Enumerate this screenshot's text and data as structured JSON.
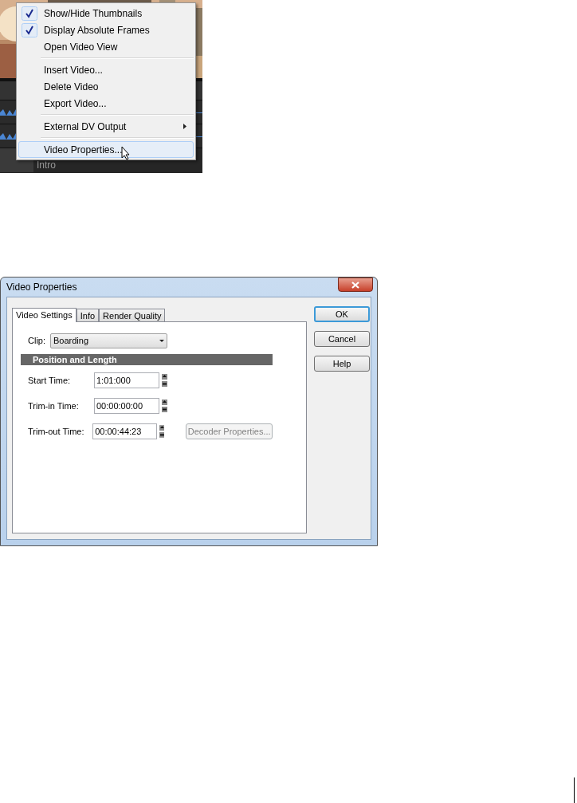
{
  "background": {
    "track_label": "Intro"
  },
  "context_menu": {
    "groups": [
      [
        {
          "label": "Show/Hide Thumbnails",
          "checked": true,
          "selected": false,
          "has_submenu": false
        },
        {
          "label": "Display Absolute Frames",
          "checked": true,
          "selected": false,
          "has_submenu": false
        },
        {
          "label": "Open Video View",
          "checked": false,
          "selected": false,
          "has_submenu": false
        }
      ],
      [
        {
          "label": "Insert Video...",
          "checked": false,
          "selected": false,
          "has_submenu": false
        },
        {
          "label": "Delete Video",
          "checked": false,
          "selected": false,
          "has_submenu": false
        },
        {
          "label": "Export Video...",
          "checked": false,
          "selected": false,
          "has_submenu": false
        }
      ],
      [
        {
          "label": "External DV Output",
          "checked": false,
          "selected": false,
          "has_submenu": true
        }
      ],
      [
        {
          "label": "Video Properties...",
          "checked": false,
          "selected": true,
          "has_submenu": false
        }
      ]
    ]
  },
  "dialog": {
    "title": "Video Properties",
    "tabs": [
      {
        "label": "Video Settings",
        "selected": true
      },
      {
        "label": "Info",
        "selected": false
      },
      {
        "label": "Render Quality",
        "selected": false
      }
    ],
    "clip": {
      "label": "Clip:",
      "value": "Boarding"
    },
    "section": "Position and Length",
    "fields": [
      {
        "label": "Start Time:",
        "value": "1:01:000"
      },
      {
        "label": "Trim-in Time:",
        "value": "00:00:00:00"
      },
      {
        "label": "Trim-out Time:",
        "value": "00:00:44:23"
      }
    ],
    "decoder_button": {
      "label": "Decoder Properties...",
      "disabled": true
    },
    "buttons": [
      {
        "label": "OK",
        "default": true
      },
      {
        "label": "Cancel",
        "default": false
      },
      {
        "label": "Help",
        "default": false
      }
    ]
  }
}
